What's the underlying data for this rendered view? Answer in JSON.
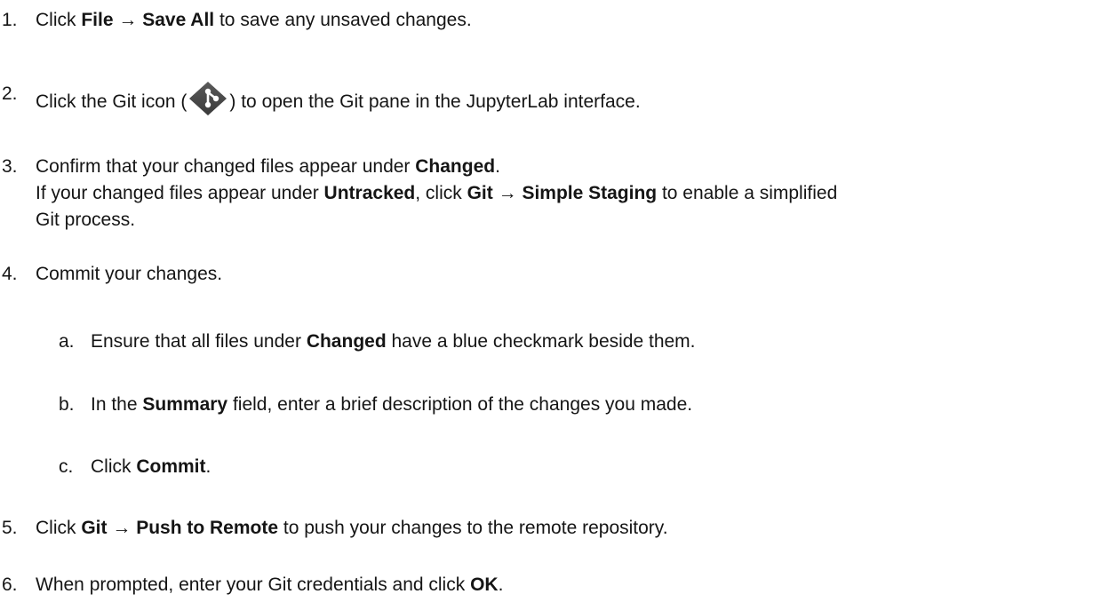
{
  "steps": [
    {
      "number": "1.",
      "parts": [
        "Click ",
        "File",
        " → ",
        "Save All",
        " to save any unsaved changes."
      ]
    },
    {
      "number": "2.",
      "before": "Click the Git icon (",
      "icon": "git-icon",
      "after": ") to open the Git pane in the JupyterLab interface."
    },
    {
      "number": "3.",
      "line1": [
        "Confirm that your changed files appear under ",
        "Changed",
        "."
      ],
      "line2": [
        "If your changed files appear under ",
        "Untracked",
        ", click ",
        "Git",
        " → ",
        "Simple Staging",
        " to enable a simplified"
      ],
      "line3": "Git process."
    },
    {
      "number": "4.",
      "text": "Commit your changes.",
      "substeps": [
        {
          "letter": "a.",
          "parts": [
            "Ensure that all files under ",
            "Changed",
            " have a blue checkmark beside them."
          ]
        },
        {
          "letter": "b.",
          "parts": [
            "In the ",
            "Summary",
            " field, enter a brief description of the changes you made."
          ]
        },
        {
          "letter": "c.",
          "parts": [
            "Click ",
            "Commit",
            "."
          ]
        }
      ]
    },
    {
      "number": "5.",
      "parts": [
        "Click ",
        "Git",
        " → ",
        "Push to Remote",
        " to push your changes to the remote repository."
      ]
    },
    {
      "number": "6.",
      "parts": [
        "When prompted, enter your Git credentials and click ",
        "OK",
        "."
      ]
    }
  ]
}
